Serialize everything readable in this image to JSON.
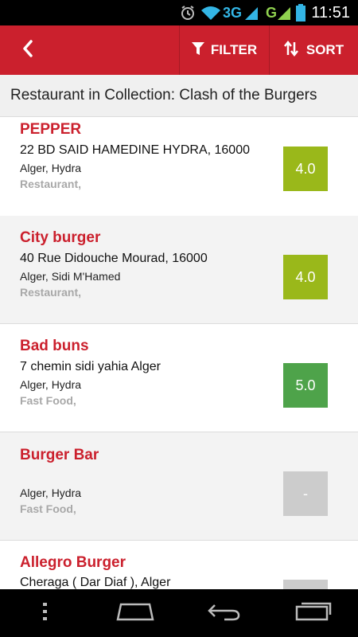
{
  "status_bar": {
    "network_3g": "3G",
    "network_g": "G",
    "time": "11:51",
    "icons": [
      "alarm-icon",
      "wifi-icon",
      "signal-icon",
      "battery-icon"
    ]
  },
  "app_bar": {
    "back_icon": "chevron-left-icon",
    "filter_label": "FILTER",
    "filter_icon": "funnel-icon",
    "sort_label": "SORT",
    "sort_icon": "sort-arrows-icon",
    "color": "#cb202d"
  },
  "header": {
    "title": "Restaurant in Collection: Clash of the Burgers"
  },
  "restaurants": [
    {
      "name": "PEPPER",
      "address": "22 BD SAID HAMEDINE HYDRA, 16000",
      "locality": "Alger, Hydra",
      "cuisine": "Restaurant,",
      "rating": "4.0",
      "rating_color": "#9ab81a"
    },
    {
      "name": "City burger",
      "address": "40 Rue Didouche Mourad, 16000",
      "locality": "Alger, Sidi M'Hamed",
      "cuisine": "Restaurant,",
      "rating": "4.0",
      "rating_color": "#9ab81a"
    },
    {
      "name": "Bad buns",
      "address": "7 chemin sidi yahia Alger",
      "locality": "Alger, Hydra",
      "cuisine": "Fast Food,",
      "rating": "5.0",
      "rating_color": "#4ea34a"
    },
    {
      "name": "Burger Bar",
      "address": "",
      "locality": "Alger, Hydra",
      "cuisine": "Fast Food,",
      "rating": "-",
      "rating_color": "#cccccc"
    },
    {
      "name": "Allegro Burger",
      "address": "Cheraga ( Dar Diaf ), Alger",
      "locality": "",
      "cuisine": "",
      "rating": "",
      "rating_color": "#cccccc"
    }
  ],
  "nav_bar": {
    "icons": [
      "menu-dots-icon",
      "home-icon",
      "back-icon",
      "recent-apps-icon"
    ]
  }
}
